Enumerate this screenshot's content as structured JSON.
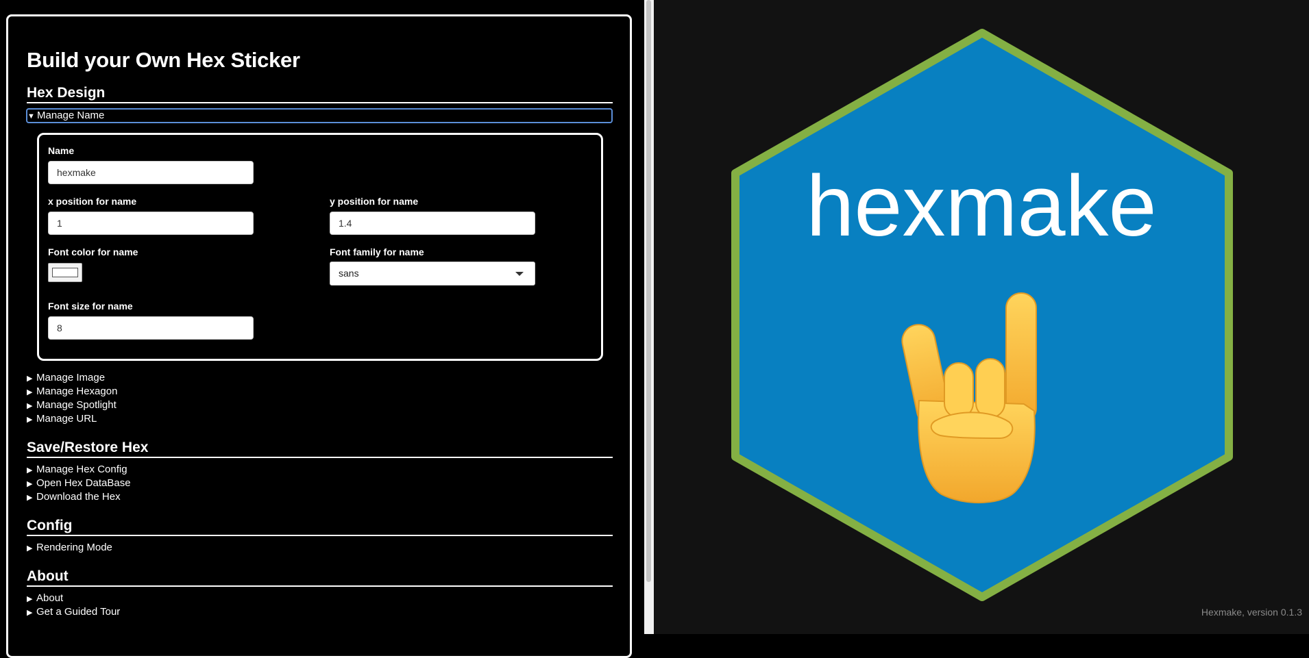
{
  "sidebar": {
    "title": "Build your Own Hex Sticker",
    "sections": {
      "hex_design": "Hex Design",
      "save_restore": "Save/Restore Hex",
      "config": "Config",
      "about": "About"
    },
    "manage_name": {
      "label": "Manage Name",
      "fields": {
        "name_label": "Name",
        "name_value": "hexmake",
        "x_label": "x position for name",
        "x_value": "1",
        "y_label": "y position for name",
        "y_value": "1.4",
        "color_label": "Font color for name",
        "color_value": "#ffffff",
        "family_label": "Font family for name",
        "family_value": "sans",
        "size_label": "Font size for name",
        "size_value": "8"
      }
    },
    "hex_items": [
      "Manage Image",
      "Manage Hexagon",
      "Manage Spotlight",
      "Manage URL"
    ],
    "save_items": [
      "Manage Hex Config",
      "Open Hex DataBase",
      "Download the Hex"
    ],
    "config_items": [
      "Rendering Mode"
    ],
    "about_items": [
      "About",
      "Get a Guided Tour"
    ]
  },
  "preview": {
    "sticker_text": "hexmake",
    "sticker_icon": "sign-of-the-horns-icon",
    "fill_color": "#0880c1",
    "border_color": "#84b044",
    "version": "Hexmake, version 0.1.3"
  }
}
